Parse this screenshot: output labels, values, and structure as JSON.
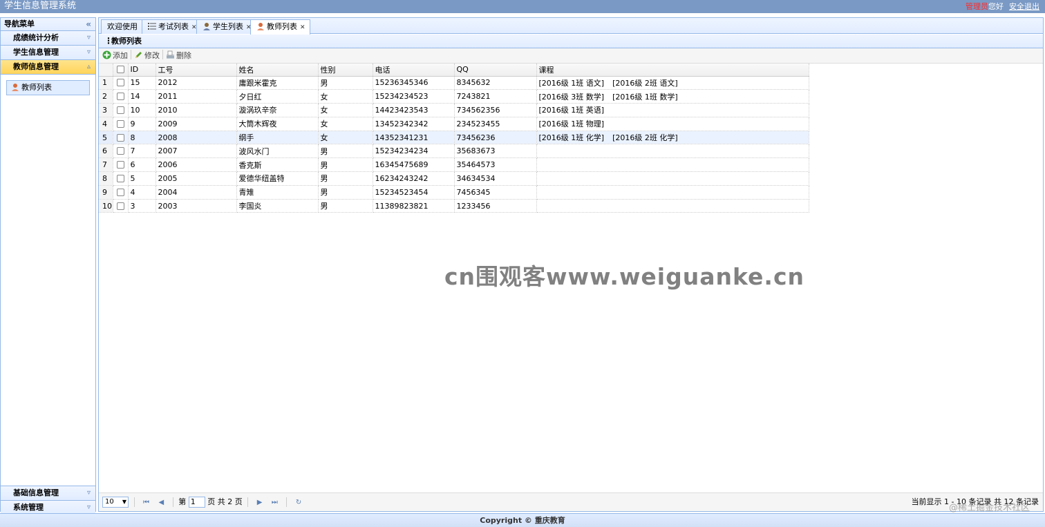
{
  "app": {
    "title": "学生信息管理系统",
    "user_role": "管理员",
    "greeting": "您好",
    "logout": "安全退出"
  },
  "sidebar": {
    "header": "导航菜单",
    "collapse_glyph": "«",
    "sections": [
      {
        "label": "成绩统计分析",
        "expanded": false
      },
      {
        "label": "学生信息管理",
        "expanded": false
      },
      {
        "label": "教师信息管理",
        "expanded": true
      }
    ],
    "active_menu_item": "教师列表",
    "bottom_sections": [
      {
        "label": "基础信息管理"
      },
      {
        "label": "系统管理"
      }
    ]
  },
  "tabs": [
    {
      "label": "欢迎使用",
      "closable": false
    },
    {
      "label": "考试列表",
      "closable": true
    },
    {
      "label": "学生列表",
      "closable": true
    },
    {
      "label": "教师列表",
      "closable": true,
      "active": true
    }
  ],
  "panel": {
    "title": "教师列表"
  },
  "toolbar": {
    "add": "添加",
    "edit": "修改",
    "delete": "删除"
  },
  "grid": {
    "columns": [
      "ID",
      "工号",
      "姓名",
      "性别",
      "电话",
      "QQ",
      "课程"
    ],
    "rows": [
      {
        "rn": "1",
        "id": "15",
        "no": "2012",
        "name": "庸跟米霍克",
        "sex": "男",
        "phone": "15236345346",
        "qq": "8345632",
        "courses": [
          "[2016级 1班 语文]",
          "[2016级 2班 语文]"
        ]
      },
      {
        "rn": "2",
        "id": "14",
        "no": "2011",
        "name": "夕日红",
        "sex": "女",
        "phone": "15234234523",
        "qq": "7243821",
        "courses": [
          "[2016级 3班 数学]",
          "[2016级 1班 数学]"
        ]
      },
      {
        "rn": "3",
        "id": "10",
        "no": "2010",
        "name": "漩涡玖辛奈",
        "sex": "女",
        "phone": "14423423543",
        "qq": "734562356",
        "courses": [
          "[2016级 1班 英语]"
        ]
      },
      {
        "rn": "4",
        "id": "9",
        "no": "2009",
        "name": "大筒木辉夜",
        "sex": "女",
        "phone": "13452342342",
        "qq": "234523455",
        "courses": [
          "[2016级 1班 物理]"
        ]
      },
      {
        "rn": "5",
        "id": "8",
        "no": "2008",
        "name": "纲手",
        "sex": "女",
        "phone": "14352341231",
        "qq": "73456236",
        "courses": [
          "[2016级 1班 化学]",
          "[2016级 2班 化学]"
        ]
      },
      {
        "rn": "6",
        "id": "7",
        "no": "2007",
        "name": "波风水门",
        "sex": "男",
        "phone": "15234234234",
        "qq": "35683673",
        "courses": []
      },
      {
        "rn": "7",
        "id": "6",
        "no": "2006",
        "name": "香克斯",
        "sex": "男",
        "phone": "16345475689",
        "qq": "35464573",
        "courses": []
      },
      {
        "rn": "8",
        "id": "5",
        "no": "2005",
        "name": "爱德华纽盖特",
        "sex": "男",
        "phone": "16234243242",
        "qq": "34634534",
        "courses": []
      },
      {
        "rn": "9",
        "id": "4",
        "no": "2004",
        "name": "青雉",
        "sex": "男",
        "phone": "15234523454",
        "qq": "7456345",
        "courses": []
      },
      {
        "rn": "10",
        "id": "3",
        "no": "2003",
        "name": "李国炎",
        "sex": "男",
        "phone": "11389823821",
        "qq": "1233456",
        "courses": []
      }
    ]
  },
  "pager": {
    "page_size": "10",
    "page_prefix": "第",
    "page_value": "1",
    "page_suffix": "页 共 2 页",
    "info": "当前显示 1 - 10 条记录 共 12 条记录"
  },
  "watermark": "cn围观客www.weiguanke.cn",
  "juejin_mark": "@稀土掘金技术社区",
  "footer": "Copyright © 重庆教育"
}
